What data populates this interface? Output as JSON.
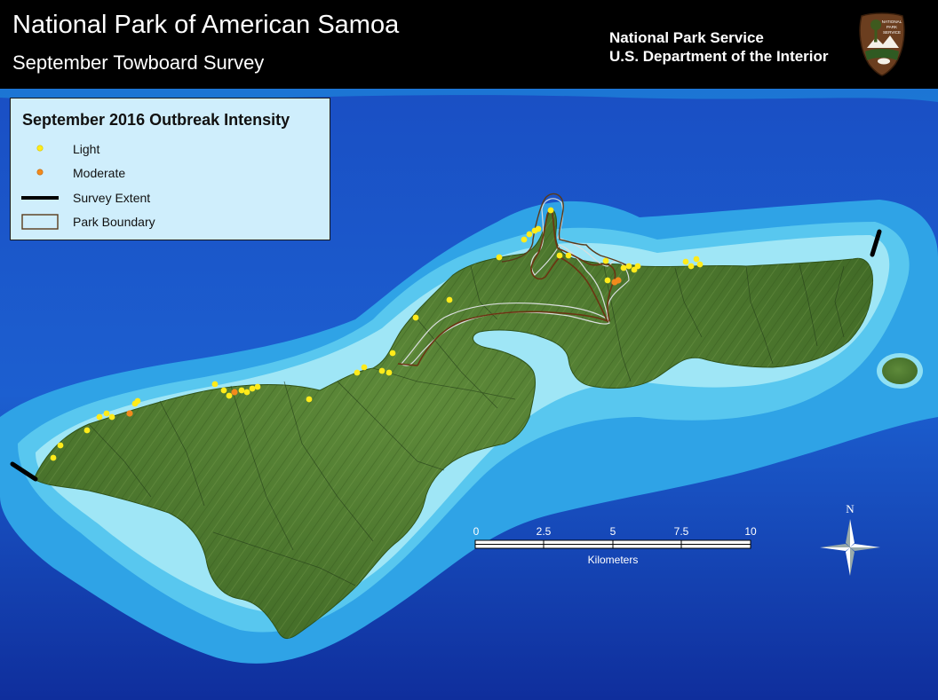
{
  "header": {
    "title": "National Park of American Samoa",
    "subtitle": "September Towboard Survey",
    "agency_line1": "National Park Service",
    "agency_line2": "U.S. Department of the Interior"
  },
  "logo": {
    "icon": "nps-arrowhead-icon",
    "text": "NATIONAL PARK SERVICE"
  },
  "legend": {
    "title": "September 2016 Outbreak Intensity",
    "items": [
      {
        "label": "Light",
        "symbol": "point",
        "color": "#ffeb1a"
      },
      {
        "label": "Moderate",
        "symbol": "point",
        "color": "#f28a1c"
      },
      {
        "label": "Survey Extent",
        "symbol": "line",
        "color": "#000000"
      },
      {
        "label": "Park Boundary",
        "symbol": "polygon",
        "color": "#5a3a1a"
      }
    ]
  },
  "scalebar": {
    "ticks": [
      "0",
      "2.5",
      "5",
      "7.5",
      "10"
    ],
    "unit": "Kilometers"
  },
  "north_arrow": {
    "label": "N",
    "icon": "north-arrow-icon"
  },
  "colors": {
    "deep_ocean": "#1438b0",
    "mid_ocean": "#1c6fd6",
    "shelf": "#3fb6e8",
    "shallow": "#8fe0f4",
    "land": "#4f7a2e",
    "light_outbreak": "#ffeb1a",
    "moderate_outbreak": "#f28a1c"
  }
}
